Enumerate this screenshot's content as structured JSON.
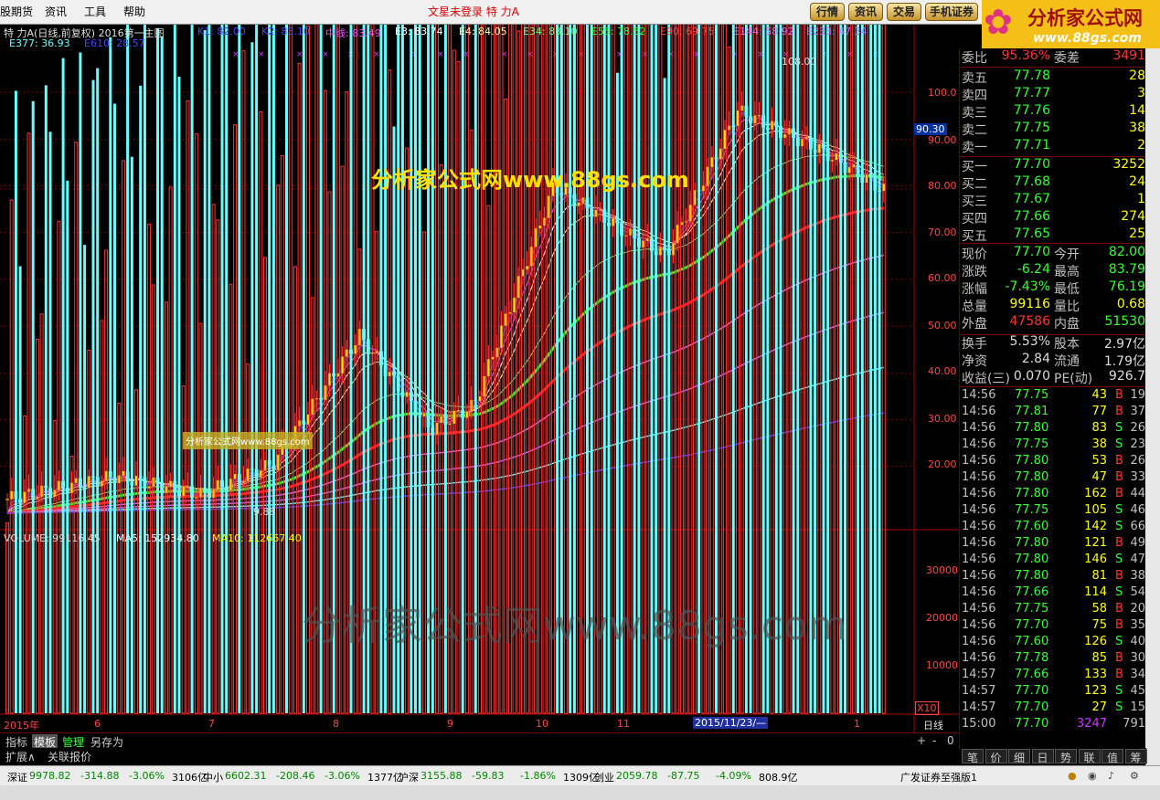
{
  "menu": [
    "股期货",
    "资讯",
    "工具",
    "帮助"
  ],
  "window_title": "文星未登录    特 力A",
  "right_buttons": [
    "行情",
    "资讯",
    "交易",
    "手机证券"
  ],
  "logo": {
    "name": "分析家公式网",
    "url": "www.88gs.com"
  },
  "price_header": {
    "line1": "特 力A(日线,前复权) 2016第一主图",
    "k1": "K1: 82.00",
    "k2": "K2: 83.10",
    "mid": "中线: 83.49",
    "e3": "E3: 83.74",
    "e4": "E4: 84.05",
    "e34": "E34: 83.10",
    "e55": "E55: 78.52",
    "e90": "E90: 69.75",
    "e144": "E144: 58.92",
    "e233": "E233: 47.34",
    "e377": "E377: 36.93",
    "e610": "E610: 28.57"
  },
  "watermark": "分析家公式网www.88gs.com",
  "watermark_small": "分析家公式网www.88gs.com",
  "watermark_big": "分析家公式网www.88gs.com",
  "price_axis": [
    "100.0",
    "90.00",
    "80.00",
    "70.00",
    "60.00",
    "50.00",
    "40.00",
    "30.00",
    "20.00"
  ],
  "price_tag": "90.30",
  "high_label": "108.00",
  "low_label": "9.88",
  "volume_header": {
    "vol": "VOLUME: 99116.45",
    "ma5": "MA5: 152934.80",
    "ma10": "MA10: 112667.40"
  },
  "volume_axis": [
    "30000",
    "20000",
    "10000"
  ],
  "volume_unit": "X10",
  "date_axis": [
    "2015年",
    "6",
    "7",
    "8",
    "9",
    "10",
    "11",
    "1"
  ],
  "date_cursor": "2015/11/23/—",
  "period": "日线",
  "bottom_tabs": [
    "指标",
    "模板",
    "管理",
    "另存为"
  ],
  "bottom_tabs2": [
    "扩展∧",
    "关联报价"
  ],
  "quote": {
    "weibi_label": "委比",
    "weibi": "95.36%",
    "weicha_label": "委差",
    "weicha": "3491",
    "sell": [
      {
        "label": "卖五",
        "price": "77.78",
        "vol": "28"
      },
      {
        "label": "卖四",
        "price": "77.77",
        "vol": "3"
      },
      {
        "label": "卖三",
        "price": "77.76",
        "vol": "14"
      },
      {
        "label": "卖二",
        "price": "77.75",
        "vol": "38"
      },
      {
        "label": "卖一",
        "price": "77.71",
        "vol": "2"
      }
    ],
    "buy": [
      {
        "label": "买一",
        "price": "77.70",
        "vol": "3252"
      },
      {
        "label": "买二",
        "price": "77.68",
        "vol": "24"
      },
      {
        "label": "买三",
        "price": "77.67",
        "vol": "1"
      },
      {
        "label": "买四",
        "price": "77.66",
        "vol": "274"
      },
      {
        "label": "买五",
        "price": "77.65",
        "vol": "25"
      }
    ],
    "stats": [
      {
        "l1": "现价",
        "v1": "77.70",
        "l2": "今开",
        "v2": "82.00",
        "c1": "#3f3",
        "c2": "#3f3"
      },
      {
        "l1": "涨跌",
        "v1": "-6.24",
        "l2": "最高",
        "v2": "83.79",
        "c1": "#3f3",
        "c2": "#3f3"
      },
      {
        "l1": "涨幅",
        "v1": "-7.43%",
        "l2": "最低",
        "v2": "76.19",
        "c1": "#3f3",
        "c2": "#3f3"
      },
      {
        "l1": "总量",
        "v1": "99116",
        "l2": "量比",
        "v2": "0.68",
        "c1": "#ff0",
        "c2": "#ff0"
      },
      {
        "l1": "外盘",
        "v1": "47586",
        "l2": "内盘",
        "v2": "51530",
        "c1": "#f33",
        "c2": "#3f3"
      }
    ],
    "stats2": [
      {
        "l1": "换手",
        "v1": "5.53%",
        "l2": "股本",
        "v2": "2.97亿"
      },
      {
        "l1": "净资",
        "v1": "2.84",
        "l2": "流通",
        "v2": "1.79亿"
      },
      {
        "l1": "收益(三)",
        "v1": "0.070",
        "l2": "PE(动)",
        "v2": "926.7"
      }
    ]
  },
  "ticks": [
    {
      "t": "14:56",
      "p": "77.75",
      "v": "43",
      "bs": "B",
      "n": "19"
    },
    {
      "t": "14:56",
      "p": "77.81",
      "v": "77",
      "bs": "B",
      "n": "37"
    },
    {
      "t": "14:56",
      "p": "77.80",
      "v": "83",
      "bs": "S",
      "n": "26"
    },
    {
      "t": "14:56",
      "p": "77.75",
      "v": "38",
      "bs": "S",
      "n": "23"
    },
    {
      "t": "14:56",
      "p": "77.80",
      "v": "53",
      "bs": "B",
      "n": "26"
    },
    {
      "t": "14:56",
      "p": "77.80",
      "v": "47",
      "bs": "B",
      "n": "33"
    },
    {
      "t": "14:56",
      "p": "77.80",
      "v": "162",
      "bs": "B",
      "n": "44"
    },
    {
      "t": "14:56",
      "p": "77.75",
      "v": "105",
      "bs": "S",
      "n": "46"
    },
    {
      "t": "14:56",
      "p": "77.60",
      "v": "142",
      "bs": "S",
      "n": "66"
    },
    {
      "t": "14:56",
      "p": "77.80",
      "v": "121",
      "bs": "B",
      "n": "49"
    },
    {
      "t": "14:56",
      "p": "77.80",
      "v": "146",
      "bs": "S",
      "n": "47"
    },
    {
      "t": "14:56",
      "p": "77.80",
      "v": "81",
      "bs": "B",
      "n": "38"
    },
    {
      "t": "14:56",
      "p": "77.66",
      "v": "114",
      "bs": "S",
      "n": "54"
    },
    {
      "t": "14:56",
      "p": "77.75",
      "v": "58",
      "bs": "B",
      "n": "20"
    },
    {
      "t": "14:56",
      "p": "77.70",
      "v": "75",
      "bs": "B",
      "n": "35"
    },
    {
      "t": "14:56",
      "p": "77.60",
      "v": "126",
      "bs": "S",
      "n": "40"
    },
    {
      "t": "14:56",
      "p": "77.78",
      "v": "85",
      "bs": "B",
      "n": "30"
    },
    {
      "t": "14:57",
      "p": "77.66",
      "v": "133",
      "bs": "B",
      "n": "34"
    },
    {
      "t": "14:57",
      "p": "77.70",
      "v": "123",
      "bs": "S",
      "n": "45"
    },
    {
      "t": "14:57",
      "p": "77.70",
      "v": "27",
      "bs": "S",
      "n": "15"
    },
    {
      "t": "15:00",
      "p": "77.70",
      "v": "3247",
      "bs": "",
      "n": "791"
    }
  ],
  "right_tabs": [
    "笔",
    "价",
    "细",
    "日",
    "势",
    "联",
    "值",
    "筹"
  ],
  "status": [
    {
      "name": "深证",
      "val": "9978.82",
      "chg": "-314.88",
      "pct": "-3.06%",
      "amt": "3106亿"
    },
    {
      "name": "中小",
      "val": "6602.31",
      "chg": "-208.46",
      "pct": "-3.06%",
      "amt": "1377亿"
    },
    {
      "name": "沪深",
      "val": "3155.88",
      "chg": "-59.83",
      "pct": "-1.86%",
      "amt": "1309亿"
    },
    {
      "name": "创业",
      "val": "2059.78",
      "chg": "-87.75",
      "pct": "-4.09%",
      "amt": "808.9亿"
    }
  ],
  "broker": "广发证券至强版1",
  "colors": {
    "up": "#ff3333",
    "down": "#33ff33",
    "k_up": "#ffdd00",
    "vol_down": "#66ffff"
  }
}
